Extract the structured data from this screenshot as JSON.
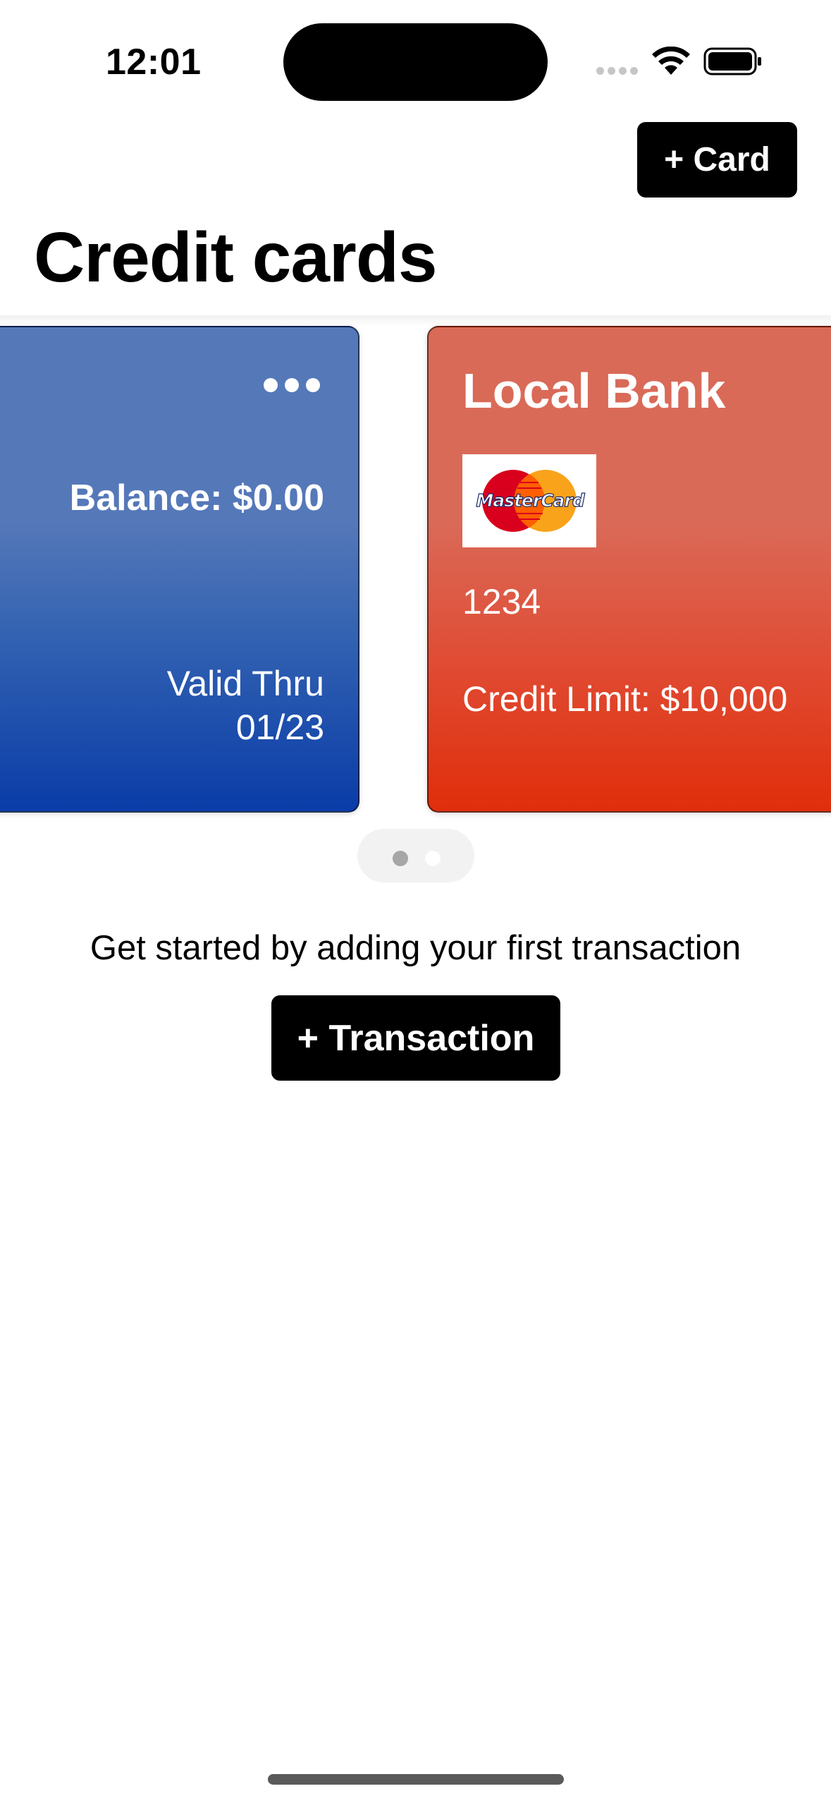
{
  "status_bar": {
    "time": "12:01"
  },
  "header": {
    "add_card_label": "+ Card",
    "title": "Credit cards"
  },
  "cards": [
    {
      "balance": "Balance: $0.00",
      "valid_thru_label": "Valid Thru",
      "valid_thru_date": "01/23",
      "colors": {
        "top": "#5578b9",
        "bottom": "#0a3ca8"
      }
    },
    {
      "bank_name": "Local Bank",
      "network_logo": "MasterCard",
      "number": "1234",
      "credit_limit": "Credit Limit: $10,000",
      "colors": {
        "top": "#d96a58",
        "bottom": "#e02e0b"
      }
    }
  ],
  "page_indicator": {
    "total": 2,
    "current": 1
  },
  "empty_state": {
    "message": "Get started by adding your first transaction",
    "add_transaction_label": "+ Transaction"
  }
}
